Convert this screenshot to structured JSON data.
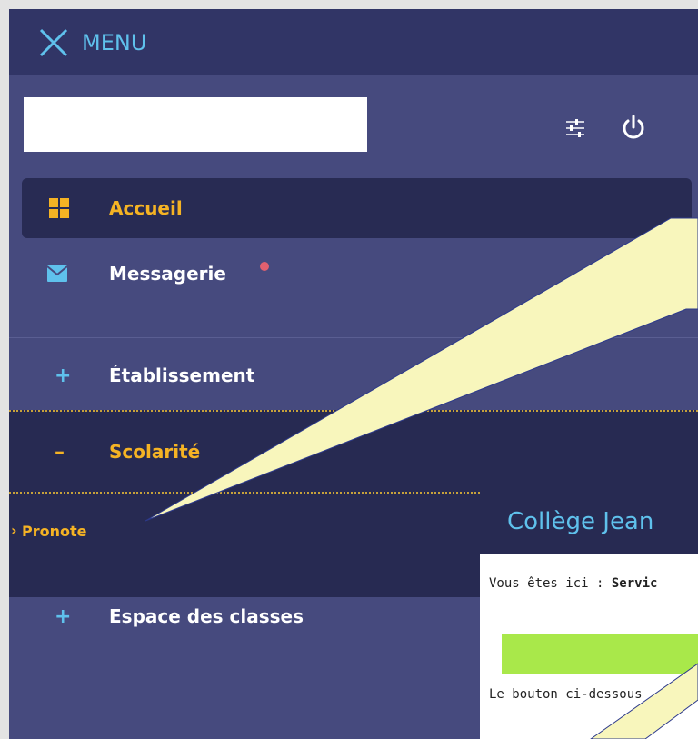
{
  "header": {
    "menu_label": "MENU"
  },
  "search": {
    "value": "",
    "placeholder": ""
  },
  "nav": {
    "home": "Accueil",
    "messaging": "Messagerie",
    "school": "Établissement",
    "schooling": "Scolarité",
    "pronote": "Pronote",
    "classes": "Espace des classes"
  },
  "content": {
    "title": "Collège Jean",
    "breadcrumb_prefix": "Vous êtes ici : ",
    "breadcrumb_current": "Servic",
    "paragraph": "Le bouton ci-dessous"
  },
  "colors": {
    "accent_yellow": "#f5b324",
    "accent_blue": "#5fc1ec",
    "notification_dot": "#e0606f",
    "callout_fill": "#f8f6bc",
    "progress_green": "#a9e84a"
  },
  "icons": [
    "close-icon",
    "settings-sliders-icon",
    "power-icon",
    "grid-icon",
    "envelope-icon",
    "notification-dot-icon",
    "plus-icon",
    "minus-icon",
    "chevron-right-icon"
  ]
}
